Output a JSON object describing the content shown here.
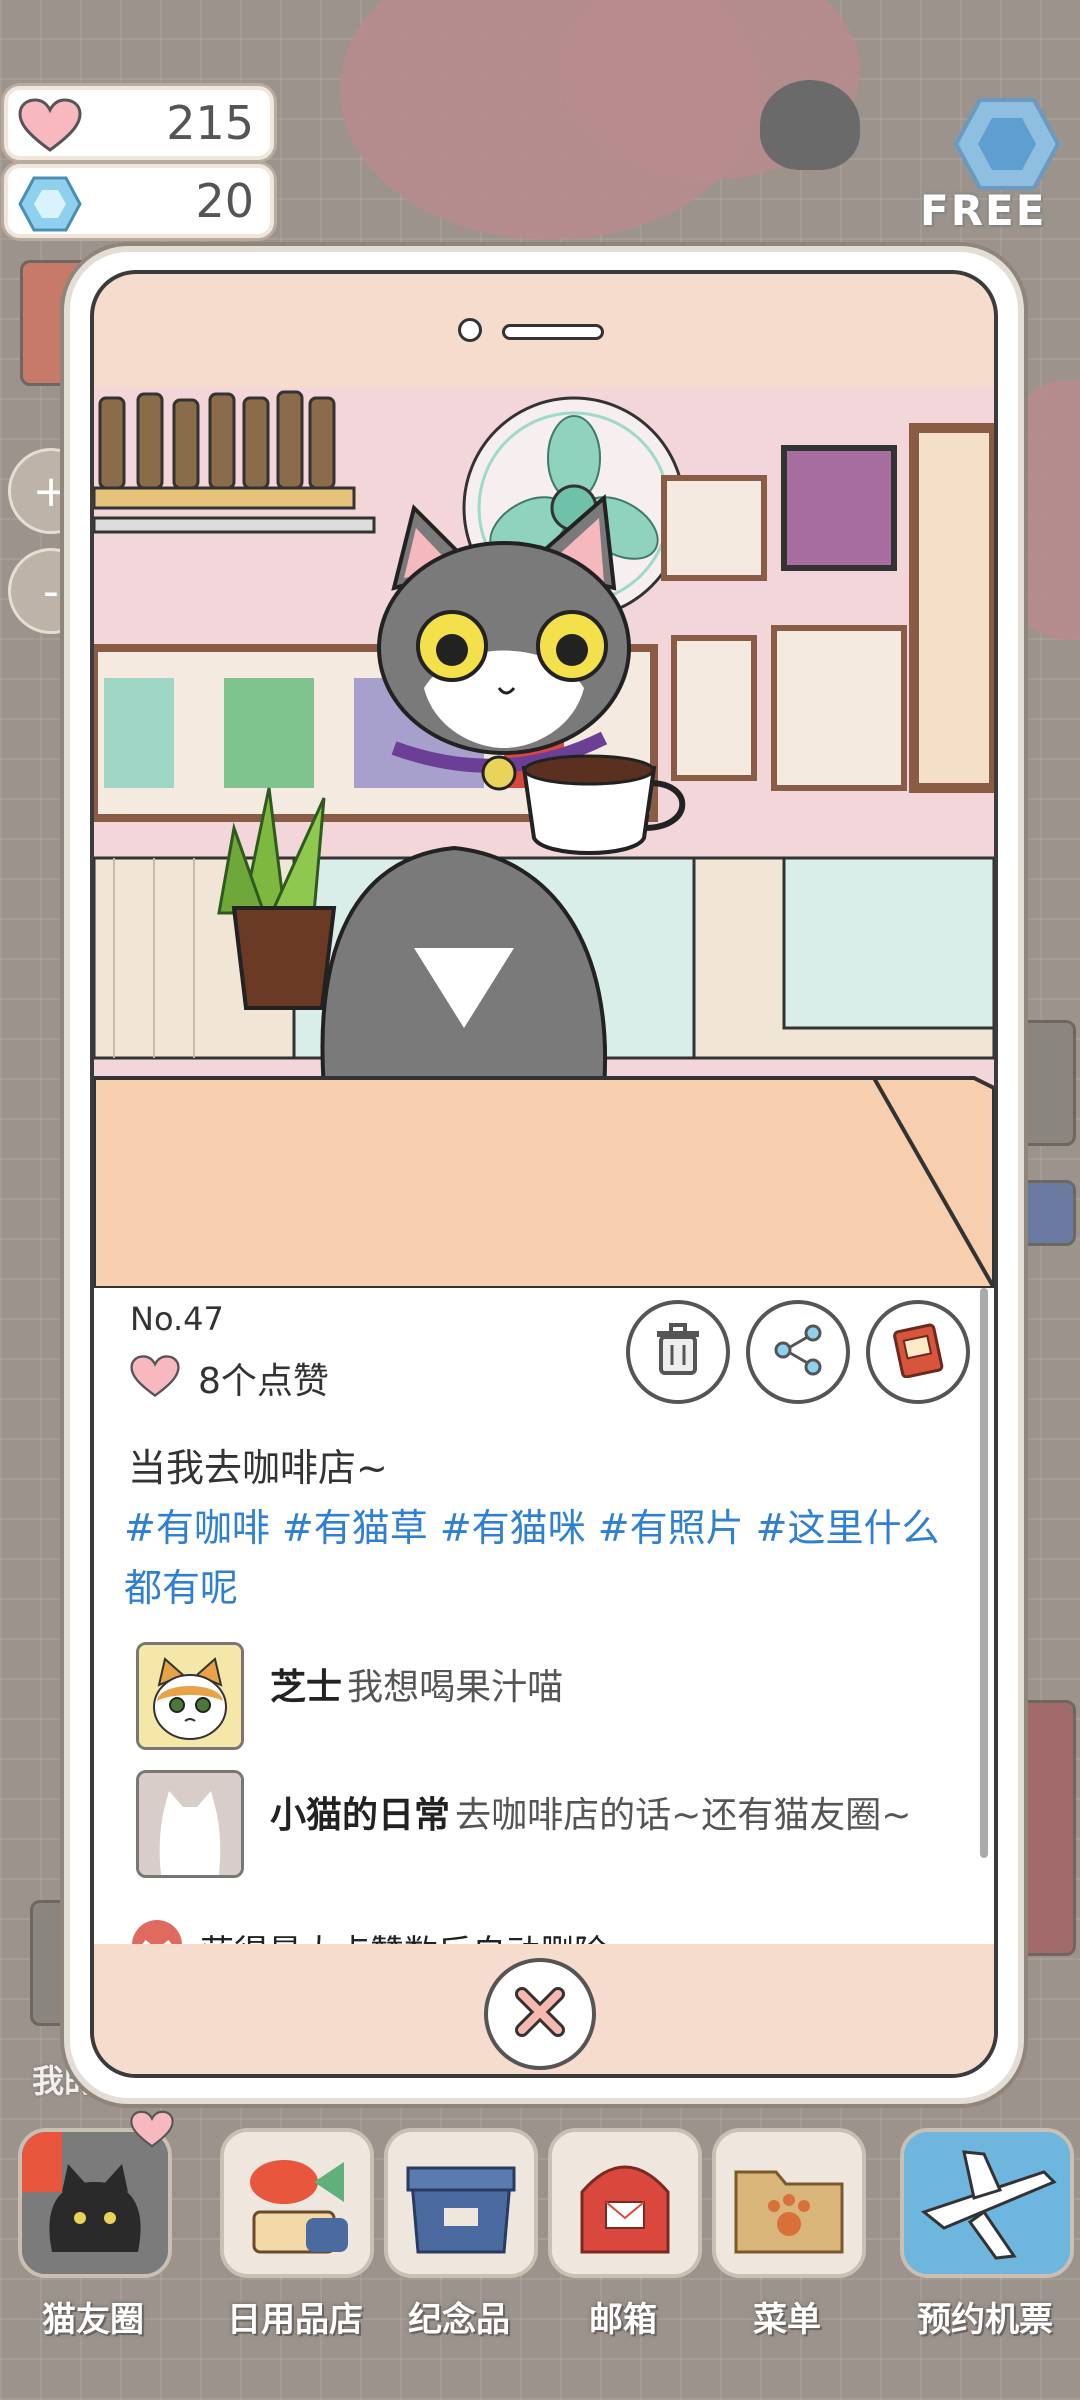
{
  "stats": {
    "hearts": "215",
    "gems": "20"
  },
  "free_label": "FREE",
  "zoom": {
    "plus": "+",
    "minus": "-"
  },
  "post": {
    "number": "No.47",
    "likes": "8个点赞",
    "text": "当我去咖啡店~",
    "tags": "#有咖啡 #有猫草 #有猫咪 #有照片 #这里什么都有呢",
    "comments": [
      {
        "name": "芝士",
        "text": "我想喝果汁喵"
      },
      {
        "name": "小猫的日常",
        "text": "去咖啡店的话~还有猫友圈~"
      }
    ],
    "notice": "获得最大点赞数后自动删除"
  },
  "side_label": "我的房",
  "dock": [
    {
      "label": "猫友圈"
    },
    {
      "label": "日用品店"
    },
    {
      "label": "纪念品"
    },
    {
      "label": "邮箱"
    },
    {
      "label": "菜单"
    },
    {
      "label": "预约机票"
    }
  ],
  "colors": {
    "tag": "#2f7fd4",
    "heart": "#f7b8c0",
    "gem": "#8fd0ee"
  }
}
